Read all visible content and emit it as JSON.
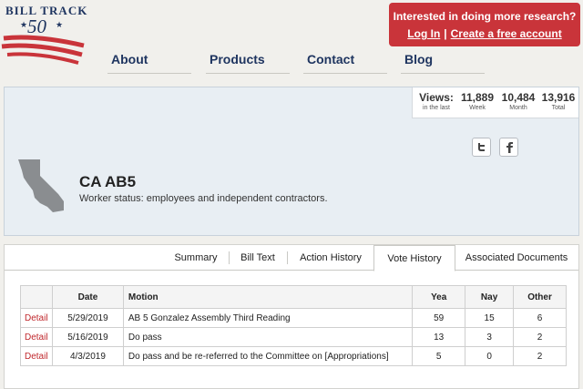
{
  "logo": {
    "text": "BILL TRACK",
    "number": "50"
  },
  "nav": [
    "About",
    "Products",
    "Contact",
    "Blog"
  ],
  "cta": {
    "title": "Interested in doing more research?",
    "login": "Log In",
    "separator": "|",
    "create": "Create a free account"
  },
  "views": {
    "label": "Views:",
    "label_sub": "in the last",
    "week_value": "11,889",
    "week_label": "Week",
    "month_value": "10,484",
    "month_label": "Month",
    "total_value": "13,916",
    "total_label": "Total"
  },
  "share": {
    "twitter_icon": "twitter-icon",
    "facebook_icon": "facebook-icon"
  },
  "bill": {
    "title": "CA AB5",
    "description": "Worker status: employees and independent contractors."
  },
  "tabs": [
    {
      "label": "Summary",
      "active": false
    },
    {
      "label": "Bill Text",
      "active": false
    },
    {
      "label": "Action History",
      "active": false
    },
    {
      "label": "Vote History",
      "active": true
    },
    {
      "label": "Associated Documents",
      "active": false
    }
  ],
  "votes": {
    "headers": [
      "",
      "Date",
      "Motion",
      "Yea",
      "Nay",
      "Other"
    ],
    "rows": [
      {
        "link": "Detail",
        "date": "5/29/2019",
        "motion": "AB 5 Gonzalez Assembly Third Reading",
        "yea": "59",
        "nay": "15",
        "other": "6"
      },
      {
        "link": "Detail",
        "date": "5/16/2019",
        "motion": "Do pass",
        "yea": "13",
        "nay": "3",
        "other": "2"
      },
      {
        "link": "Detail",
        "date": "4/3/2019",
        "motion": "Do pass and be re-referred to the Committee on [Appropriations]",
        "yea": "5",
        "nay": "0",
        "other": "2"
      }
    ]
  },
  "colors": {
    "brand_navy": "#1f3560",
    "brand_red": "#c9343a",
    "panel_bg": "#e8eef3",
    "link_red": "#c0282d"
  }
}
